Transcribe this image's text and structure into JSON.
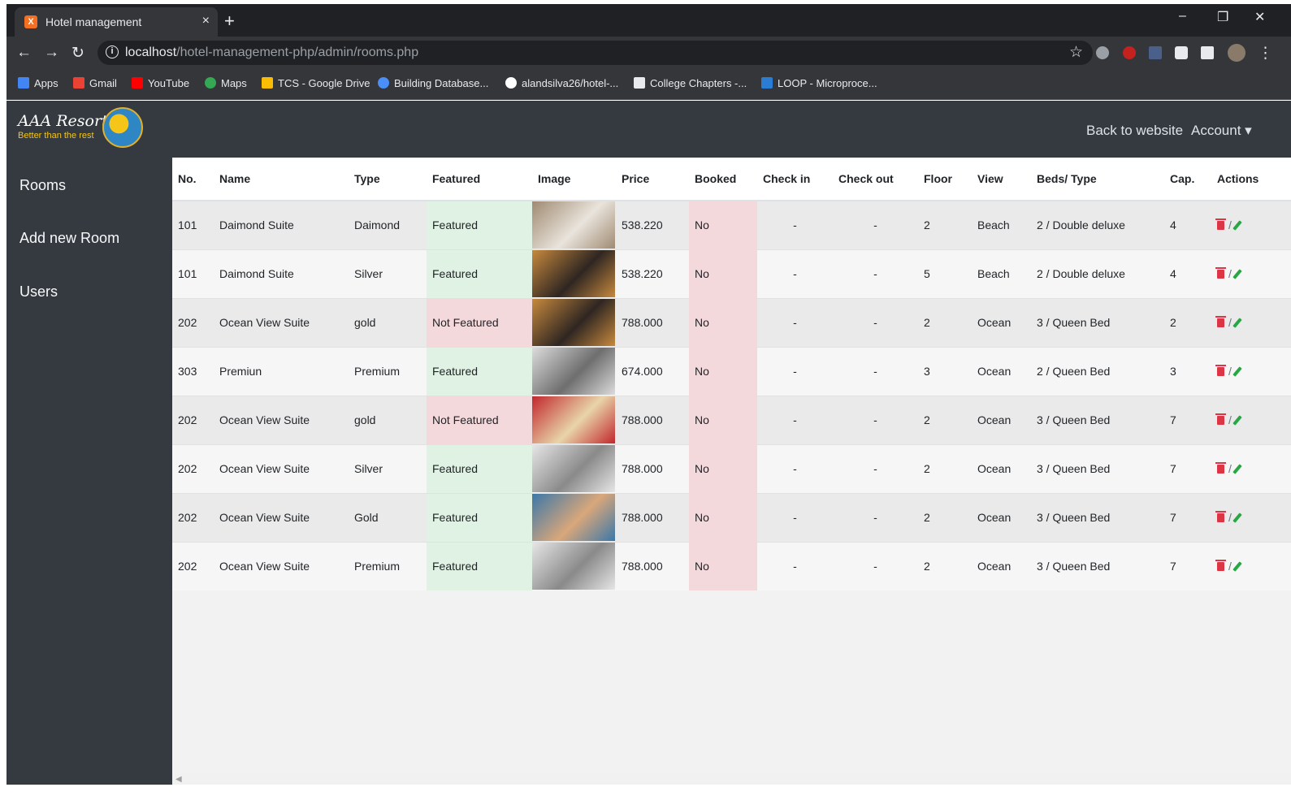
{
  "browser": {
    "tab_title": "Hotel management",
    "tab_close": "×",
    "new_tab": "+",
    "url_host": "localhost",
    "url_path": "/hotel-management-php/admin/rooms.php",
    "bookmarks": [
      {
        "label": "Apps",
        "color": "#4285f4"
      },
      {
        "label": "Gmail",
        "color": "#ea4335"
      },
      {
        "label": "YouTube",
        "color": "#ff0000"
      },
      {
        "label": "Maps",
        "color": "#34a853"
      },
      {
        "label": "TCS - Google Drive",
        "color": "#fbbc04"
      },
      {
        "label": "Building Database...",
        "color": "#4a8ef7"
      },
      {
        "label": "alandsilva26/hotel-...",
        "color": "#ffffff"
      },
      {
        "label": "College Chapters -...",
        "color": "#e8eaed"
      },
      {
        "label": "LOOP - Microproce...",
        "color": "#2b7cd3"
      }
    ]
  },
  "header": {
    "logo_text": "AAA Resorts",
    "logo_tagline": "Better than the rest",
    "back_link": "Back to website",
    "account_link": "Account ▾"
  },
  "sidebar": {
    "items": [
      {
        "label": "Rooms"
      },
      {
        "label": "Add new Room"
      },
      {
        "label": "Users"
      }
    ]
  },
  "table": {
    "headers": [
      "No.",
      "Name",
      "Type",
      "Featured",
      "Image",
      "Price",
      "Booked",
      "Check in",
      "Check out",
      "Floor",
      "View",
      "Beds/ Type",
      "Cap.",
      "Actions"
    ],
    "rows": [
      {
        "no": "101",
        "name": "Daimond Suite",
        "type": "Daimond",
        "featured": "Featured",
        "price": "538.220",
        "booked": "No",
        "checkin": "-",
        "checkout": "-",
        "floor": "2",
        "view": "Beach",
        "beds": "2 / Double deluxe",
        "cap": "4",
        "img": [
          "#a08a72",
          "#e9e4dc"
        ]
      },
      {
        "no": "101",
        "name": "Daimond Suite",
        "type": "Silver",
        "featured": "Featured",
        "price": "538.220",
        "booked": "No",
        "checkin": "-",
        "checkout": "-",
        "floor": "5",
        "view": "Beach",
        "beds": "2 / Double deluxe",
        "cap": "4",
        "img": [
          "#c7893e",
          "#2f2622"
        ]
      },
      {
        "no": "202",
        "name": "Ocean View Suite",
        "type": "gold",
        "featured": "Not Featured",
        "price": "788.000",
        "booked": "No",
        "checkin": "-",
        "checkout": "-",
        "floor": "2",
        "view": "Ocean",
        "beds": "3 / Queen Bed",
        "cap": "2",
        "img": [
          "#c7893e",
          "#2f2622"
        ]
      },
      {
        "no": "303",
        "name": "Premiun",
        "type": "Premium",
        "featured": "Featured",
        "price": "674.000",
        "booked": "No",
        "checkin": "-",
        "checkout": "-",
        "floor": "3",
        "view": "Ocean",
        "beds": "2 / Queen Bed",
        "cap": "3",
        "img": [
          "#dcdcdc",
          "#6e6e6e"
        ]
      },
      {
        "no": "202",
        "name": "Ocean View Suite",
        "type": "gold",
        "featured": "Not Featured",
        "price": "788.000",
        "booked": "No",
        "checkin": "-",
        "checkout": "-",
        "floor": "2",
        "view": "Ocean",
        "beds": "3 / Queen Bed",
        "cap": "7",
        "img": [
          "#c1272d",
          "#e8d5a8"
        ]
      },
      {
        "no": "202",
        "name": "Ocean View Suite",
        "type": "Silver",
        "featured": "Featured",
        "price": "788.000",
        "booked": "No",
        "checkin": "-",
        "checkout": "-",
        "floor": "2",
        "view": "Ocean",
        "beds": "3 / Queen Bed",
        "cap": "7",
        "img": [
          "#e6e6e6",
          "#8a8a8a"
        ]
      },
      {
        "no": "202",
        "name": "Ocean View Suite",
        "type": "Gold",
        "featured": "Featured",
        "price": "788.000",
        "booked": "No",
        "checkin": "-",
        "checkout": "-",
        "floor": "2",
        "view": "Ocean",
        "beds": "3 / Queen Bed",
        "cap": "7",
        "img": [
          "#3b78a8",
          "#d9a77a"
        ]
      },
      {
        "no": "202",
        "name": "Ocean View Suite",
        "type": "Premium",
        "featured": "Featured",
        "price": "788.000",
        "booked": "No",
        "checkin": "-",
        "checkout": "-",
        "floor": "2",
        "view": "Ocean",
        "beds": "3 / Queen Bed",
        "cap": "7",
        "img": [
          "#e6e6e6",
          "#8a8a8a"
        ]
      }
    ],
    "action_separator": "/"
  },
  "icons": {
    "delete": "trash-icon",
    "edit": "pencil-icon"
  },
  "colors": {
    "featured_bg": "#e0f2e3",
    "not_featured_bg": "#f4d9dc",
    "delete": "#dc3545",
    "edit": "#28a745",
    "header_bg": "#343a40"
  }
}
